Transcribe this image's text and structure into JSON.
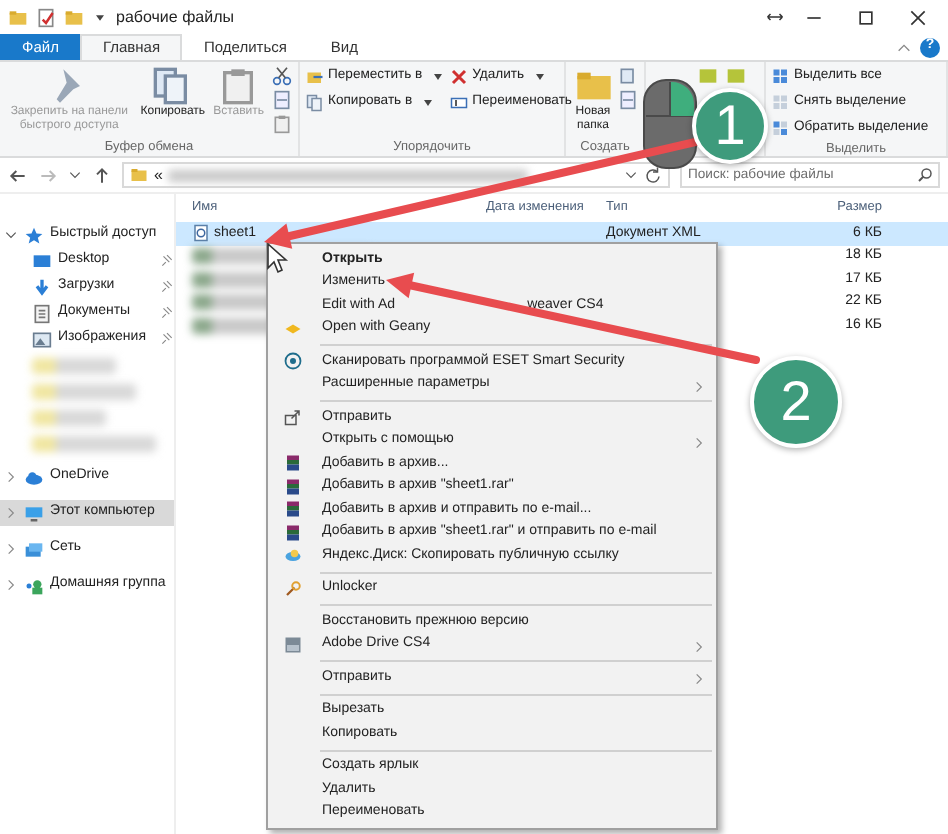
{
  "window": {
    "title": "рабочие файлы",
    "help": "?"
  },
  "ribbon_tabs": [
    {
      "label": "Файл",
      "kind": "file",
      "selected": false
    },
    {
      "label": "Главная",
      "kind": "tab",
      "selected": true
    },
    {
      "label": "Поделиться",
      "kind": "tab",
      "selected": false
    },
    {
      "label": "Вид",
      "kind": "tab",
      "selected": false
    }
  ],
  "ribbon_groups": [
    {
      "label": "Буфер обмена",
      "columns": [
        [
          {
            "kind": "large",
            "label": "Закрепить на панели быстрого доступа",
            "disabled": true
          }
        ],
        [
          {
            "kind": "large",
            "label": "Копировать",
            "disabled": false
          }
        ],
        [
          {
            "kind": "large",
            "label": "Вставить",
            "disabled": true
          }
        ],
        [
          {
            "kind": "icon"
          },
          {
            "kind": "icon"
          },
          {
            "kind": "icon"
          }
        ]
      ]
    },
    {
      "label": "Упорядочить",
      "columns": [
        [
          {
            "kind": "small",
            "label": "Переместить в",
            "menu": true
          },
          {
            "kind": "small",
            "label": "Копировать в",
            "menu": true
          }
        ],
        [
          {
            "kind": "small",
            "label": "Удалить",
            "menu": true
          },
          {
            "kind": "small",
            "label": "Переименовать",
            "menu": false
          }
        ]
      ]
    },
    {
      "label": "Создать",
      "columns": [
        [
          {
            "kind": "large",
            "label": "Новая папка",
            "disabled": false
          }
        ],
        [
          {
            "kind": "icon"
          },
          {
            "kind": "icon"
          }
        ]
      ]
    },
    {
      "columns": [
        [
          {
            "kind": "icon"
          }
        ],
        [
          {
            "kind": "icon"
          }
        ]
      ]
    },
    {
      "label": "Выделить",
      "columns": [
        [
          {
            "kind": "small",
            "label": "Выделить все",
            "menu": false
          },
          {
            "kind": "small",
            "label": "Снять выделение",
            "menu": false
          },
          {
            "kind": "small",
            "label": "Обратить выделение",
            "menu": false
          }
        ]
      ]
    }
  ],
  "address": {
    "prefix": "«",
    "search_placeholder": "Поиск: рабочие файлы"
  },
  "nav": [
    {
      "label": "Быстрый доступ",
      "expanded": true,
      "selected": false,
      "children": [
        {
          "kind": "folder",
          "label": "Desktop",
          "pinned": true
        },
        {
          "kind": "folder",
          "label": "Загрузки",
          "pinned": true
        },
        {
          "kind": "folder",
          "label": "Документы",
          "pinned": true
        },
        {
          "kind": "folder",
          "label": "Изображения",
          "pinned": true
        },
        {
          "kind": "blurred"
        },
        {
          "kind": "blurred"
        },
        {
          "kind": "blurred"
        },
        {
          "kind": "blurred"
        }
      ]
    },
    {
      "label": "OneDrive",
      "expanded": false,
      "selected": false
    },
    {
      "label": "Этот компьютер",
      "expanded": false,
      "selected": true
    },
    {
      "label": "Сеть",
      "expanded": false,
      "selected": false
    },
    {
      "label": "Домашняя группа",
      "expanded": false,
      "selected": false
    }
  ],
  "files": {
    "columns": [
      "Имя",
      "Дата изменения",
      "Тип",
      "Размер"
    ],
    "rows": [
      {
        "name": "sheet1",
        "type": "Документ XML",
        "size": "6 КБ",
        "selected": true
      },
      {
        "size": "18 КБ",
        "selected": false
      },
      {
        "size": "17 КБ",
        "selected": false
      },
      {
        "size": "22 КБ",
        "selected": false
      },
      {
        "size": "16 КБ",
        "selected": false
      }
    ]
  },
  "context_menu": [
    {
      "kind": "item",
      "label": "Открыть",
      "bold": true
    },
    {
      "kind": "item",
      "label": "Изменить"
    },
    {
      "kind": "item",
      "label": "Edit with Ad",
      "label_end": "weaver CS4"
    },
    {
      "kind": "item",
      "label": "Open with Geany"
    },
    {
      "kind": "separator"
    },
    {
      "kind": "item",
      "label": "Сканировать программой ESET Smart Security"
    },
    {
      "kind": "item",
      "label": "Расширенные параметры",
      "submenu": true
    },
    {
      "kind": "separator"
    },
    {
      "kind": "item",
      "label": "Отправить"
    },
    {
      "kind": "item",
      "label": "Открыть с помощью",
      "submenu": true
    },
    {
      "kind": "item",
      "label": "Добавить в архив..."
    },
    {
      "kind": "item",
      "label": "Добавить в архив \"sheet1.rar\""
    },
    {
      "kind": "item",
      "label": "Добавить в архив и отправить по e-mail..."
    },
    {
      "kind": "item",
      "label": "Добавить в архив \"sheet1.rar\" и отправить по e-mail"
    },
    {
      "kind": "item",
      "label": "Яндекс.Диск: Скопировать публичную ссылку"
    },
    {
      "kind": "separator"
    },
    {
      "kind": "item",
      "label": "Unlocker"
    },
    {
      "kind": "separator"
    },
    {
      "kind": "item",
      "label": "Восстановить прежнюю версию"
    },
    {
      "kind": "item",
      "label": "Adobe Drive CS4",
      "submenu": true
    },
    {
      "kind": "separator"
    },
    {
      "kind": "item",
      "label": "Отправить",
      "submenu": true
    },
    {
      "kind": "separator"
    },
    {
      "kind": "item",
      "label": "Вырезать"
    },
    {
      "kind": "item",
      "label": "Копировать"
    },
    {
      "kind": "separator"
    },
    {
      "kind": "item",
      "label": "Создать ярлык"
    },
    {
      "kind": "item",
      "label": "Удалить"
    },
    {
      "kind": "item",
      "label": "Переименовать"
    }
  ],
  "annotations": [
    {
      "label": "1"
    },
    {
      "label": "2"
    }
  ]
}
